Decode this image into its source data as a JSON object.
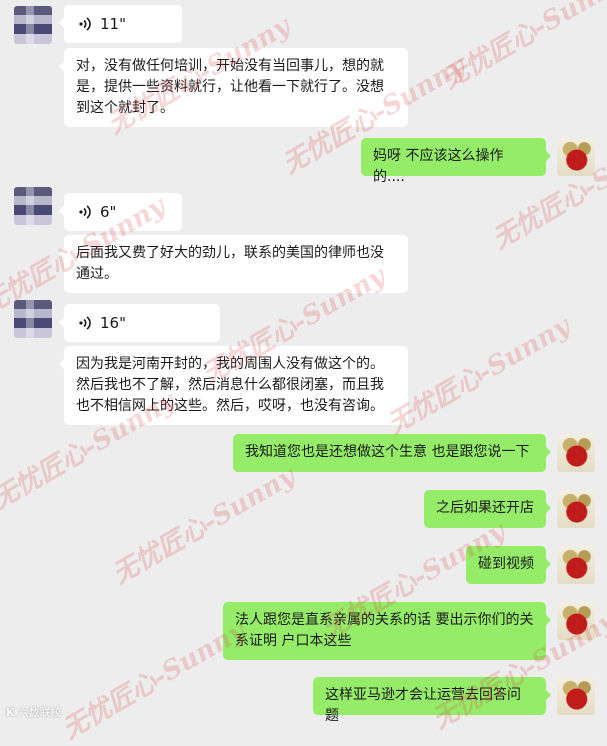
{
  "messages": [
    {
      "side": "in",
      "type": "voice",
      "duration": "11\""
    },
    {
      "side": "in",
      "type": "text",
      "text": "对，没有做任何培训，开始没有当回事儿，想的就是，提供一些资料就行，让他看一下就行了。没想到这个就封了。"
    },
    {
      "side": "out",
      "type": "text",
      "text": "妈呀  不应该这么操作的...."
    },
    {
      "side": "in",
      "type": "voice",
      "duration": "6\""
    },
    {
      "side": "in",
      "type": "text",
      "text": "后面我又费了好大的劲儿，联系的美国的律师也没通过。"
    },
    {
      "side": "in",
      "type": "voice",
      "duration": "16\""
    },
    {
      "side": "in",
      "type": "text",
      "text": "因为我是河南开封的，我的周围人没有做这个的。然后我也不了解，然后消息什么都很闭塞，而且我也不相信网上的这些。然后，哎呀，也没有咨询。"
    },
    {
      "side": "out",
      "type": "text",
      "text": "我知道您也是还想做这个生意  也是跟您说一下"
    },
    {
      "side": "out",
      "type": "text",
      "text": "之后如果还开店"
    },
    {
      "side": "out",
      "type": "text",
      "text": "碰到视频"
    },
    {
      "side": "out",
      "type": "text",
      "text": "法人跟您是直系亲属的关系的话  要出示你们的关系证明  户口本这些"
    },
    {
      "side": "out",
      "type": "text",
      "text": "这样亚马逊才会让运营去回答问题"
    }
  ],
  "watermark": "无忧匠心-Sunny",
  "corner_logo": {
    "mark": "K",
    "text": "六数联校"
  },
  "colors": {
    "background": "#ededed",
    "incoming": "#ffffff",
    "outgoing": "#95ec69"
  }
}
